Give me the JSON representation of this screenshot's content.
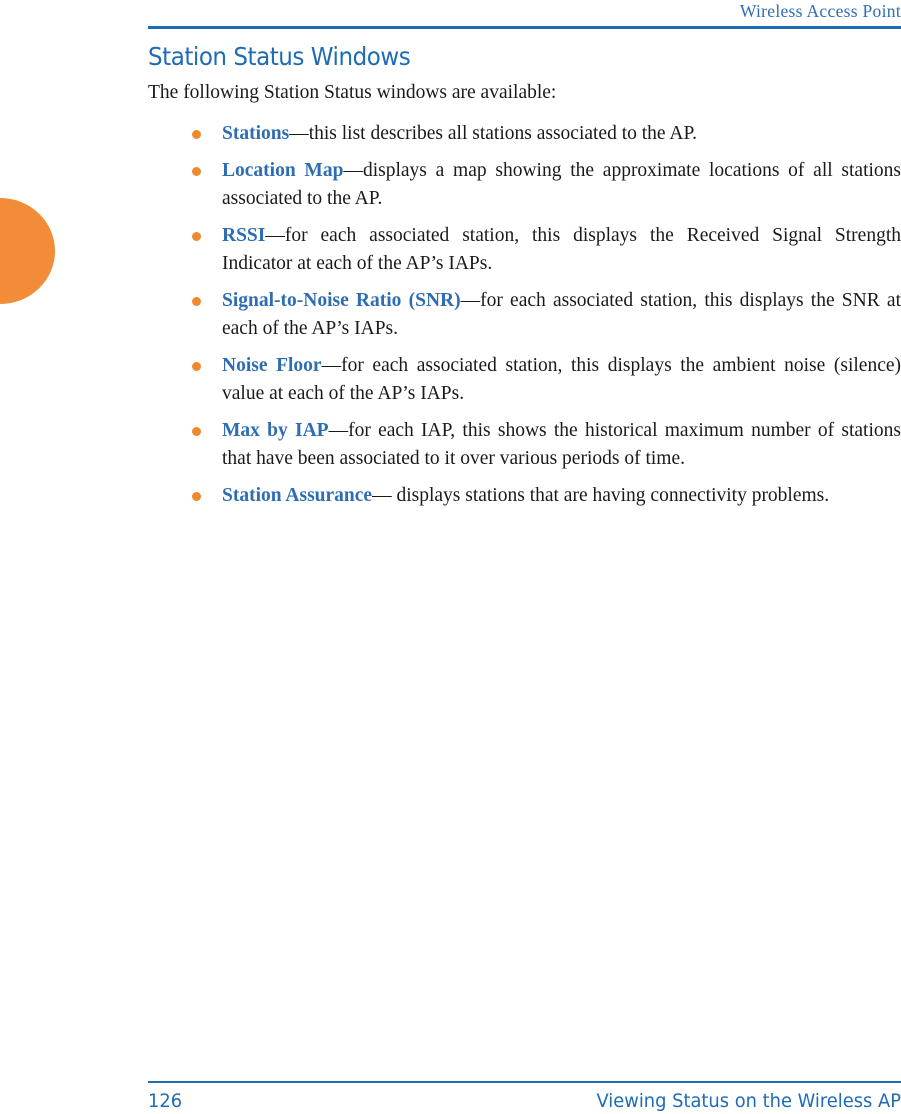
{
  "header": {
    "running_title": "Wireless Access Point"
  },
  "section": {
    "title": "Station Status Windows",
    "intro": "The following Station Status windows are available:"
  },
  "bullets": [
    {
      "term": "Stations",
      "text": "—this list describes all stations associated to the AP."
    },
    {
      "term": "Location Map",
      "text": "—displays a map showing the approximate locations of all stations associated to the AP."
    },
    {
      "term": "RSSI",
      "text": "—for each associated station, this displays the Received Signal Strength Indicator at each of the AP’s IAPs."
    },
    {
      "term": "Signal-to-Noise Ratio (SNR)",
      "text": "—for each associated station, this displays the SNR at each of the AP’s IAPs."
    },
    {
      "term": "Noise Floor",
      "text": "—for each associated station, this displays the ambient noise (silence) value at each of the AP’s IAPs."
    },
    {
      "term": "Max by IAP",
      "text": "—for each IAP, this shows the historical maximum number of stations that have been associated to it over various periods of time."
    },
    {
      "term": "Station Assurance",
      "text": "— displays stations that are having connectivity problems."
    }
  ],
  "footer": {
    "page_number": "126",
    "title": "Viewing Status on the Wireless AP"
  },
  "colors": {
    "accent_blue": "#1F6CB5",
    "term_blue": "#2E6DB4",
    "bullet_orange": "#F0882E",
    "tab_orange": "#F28C38"
  }
}
